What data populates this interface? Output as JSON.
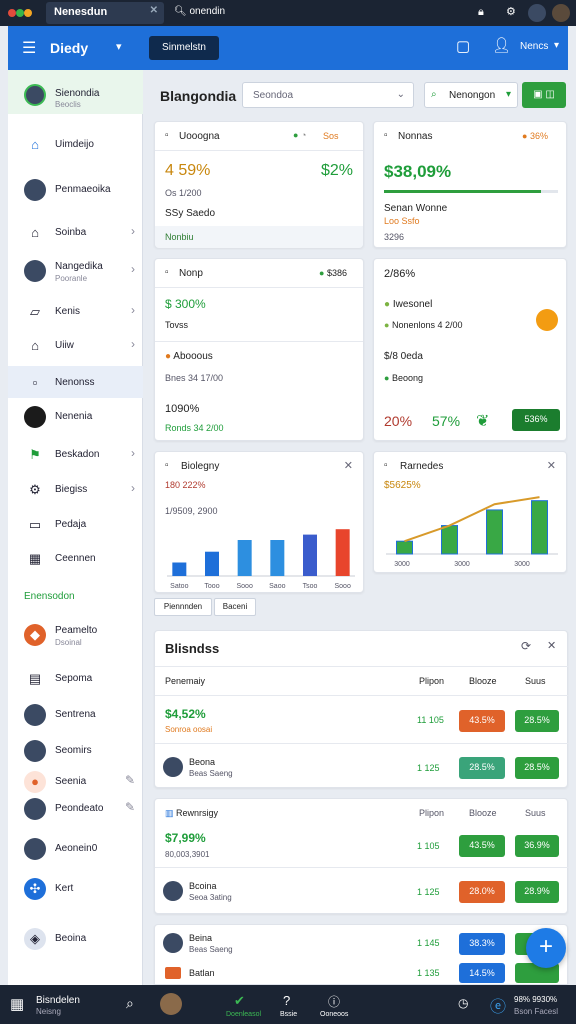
{
  "topbar": {
    "tab_active": "Nenesdun",
    "tab_other": "onendin"
  },
  "appbar": {
    "title": "Diedy",
    "top_button": "Sinmelstn",
    "account_label": "Nencs"
  },
  "sidebar": {
    "items": [
      {
        "label": "Sienondia",
        "sub": "Beoclis"
      },
      {
        "label": "Uimdeijo"
      },
      {
        "label": "Penmaeoika"
      },
      {
        "label": "Soinba"
      },
      {
        "label": "Nangedika",
        "sub": "Pooranle"
      },
      {
        "label": "Kenis"
      },
      {
        "label": "Uiiw"
      },
      {
        "label": "Nenonss"
      },
      {
        "label": "Nenenia"
      },
      {
        "label": "Beskadon"
      },
      {
        "label": "Biegiss"
      },
      {
        "label": "Pedaja"
      },
      {
        "label": "Ceennen"
      },
      {
        "label": "Peamelto",
        "sub": "Dsoinal"
      },
      {
        "label": "Sepoma"
      },
      {
        "label": "Sentrena"
      },
      {
        "label": "Seomirs"
      },
      {
        "label": "Seenia"
      },
      {
        "label": "Peondeato"
      },
      {
        "label": "Aeonein0"
      },
      {
        "label": "Kert"
      },
      {
        "label": "Beoina"
      }
    ],
    "section": "Enensodon"
  },
  "main": {
    "heading": "Blangondia",
    "search_placeholder": "Seondoa",
    "search_button": "Nenongon"
  },
  "cards": {
    "c1": {
      "title": "Uooogna",
      "badge": "Sos",
      "big_left": "4 59%",
      "big_right": "$2%",
      "l1": "Os 1/200",
      "l2": "SSy Saedo",
      "foot": "Nonbiu"
    },
    "c2": {
      "title": "Nonnas",
      "badge": "36%",
      "big": "$38,09%",
      "progress": 0.9,
      "l1": "Senan Wonne",
      "l2": "Loo Ssfo",
      "l3": "3296"
    },
    "c3": {
      "title": "Nonp",
      "badge": "$386",
      "v1": "$ 300%",
      "l1": "Tovss",
      "l2": "Abooous",
      "l3": "Bnes 34 17/00",
      "v2": "1090%",
      "l4": "Ronds 34 2/00"
    },
    "c4": {
      "v0": "2/86%",
      "l1": "Iwesonel",
      "l2": "Nonenlons 4 2/00",
      "l3": "$/8 0eda",
      "l4": "Beoong",
      "pct1": "20%",
      "pct2": "57%",
      "button": "536%"
    },
    "c5": {
      "title": "Biolegny",
      "v": "180 222%",
      "l1": "1/9509, 2900"
    },
    "c6": {
      "title": "Rarnedes",
      "v": "$5625%"
    },
    "filters": [
      "Piennnden",
      "Baceni"
    ]
  },
  "chart_data": [
    {
      "type": "bar",
      "categories": [
        "Satoo",
        "Tooo",
        "Sooo",
        "Saoo",
        "Tsoo",
        "Sooo"
      ],
      "values": [
        15,
        27,
        40,
        40,
        46,
        52
      ],
      "colors": [
        "#1e6fd9",
        "#1e6fd9",
        "#2d8fe0",
        "#2d8fe0",
        "#3a5ccc",
        "#e8452c"
      ],
      "ylim": [
        0,
        60
      ]
    },
    {
      "type": "bar",
      "categories": [
        "3000",
        "",
        "3000",
        "",
        "3000"
      ],
      "values": [
        18,
        40,
        62,
        75
      ],
      "trend": [
        18,
        40,
        70,
        80
      ],
      "ylim": [
        0,
        90
      ]
    }
  ],
  "table": {
    "title": "Blisndss",
    "columns": [
      "Penemaiy",
      "Plipon",
      "Blooze",
      "Suus"
    ],
    "groups": [
      {
        "head": "$4,52%",
        "sub": "Sonroa oosai",
        "rows": [
          {
            "name": "Beona",
            "sub": "Beas Saeng",
            "a": "1 125",
            "b": "28.5%",
            "c": "28.5%",
            "bcolor": "#e0622a",
            "ccolor": "#2e9e3e"
          }
        ],
        "a0": "11 105",
        "b0": "43.5%",
        "c0": "28.5%",
        "bcolor0": "#e0622a",
        "ccolor0": "#2e9e3e"
      },
      {
        "head": "Rewnrsigy",
        "v": "$7,99%",
        "sub": "80,003,3901",
        "rows": [
          {
            "name": "Bcoina",
            "sub": "Seoa 3ating",
            "a": "1 125",
            "b": "28.0%",
            "c": "28.9%",
            "bcolor": "#e0622a",
            "ccolor": "#2e9e3e"
          }
        ],
        "a0": "1 105",
        "b0": "43.5%",
        "c0": "36.9%",
        "bcolor0": "#2e9e3e",
        "ccolor0": "#2e9e3e"
      },
      {
        "rows": [
          {
            "name": "Beina",
            "sub": "Beas Saeng",
            "a": "1 145",
            "b": "38.3%",
            "c": "",
            "bcolor": "#1e6fd9",
            "ccolor": "#2e9e3e"
          },
          {
            "name": "Batlan",
            "sub": "",
            "a": "1 135",
            "b": "14.5%",
            "c": "",
            "bcolor": "#1e6fd9",
            "ccolor": "#2e9e3e"
          }
        ]
      }
    ]
  },
  "bottombar": {
    "title": "Bisndelen",
    "sub": "Neisng",
    "tab1": "Doenleasol",
    "tab2": "Bssie",
    "tab3": "Ooneoos",
    "status": "98% 9930%",
    "status_sub": "Bson Facesl"
  }
}
